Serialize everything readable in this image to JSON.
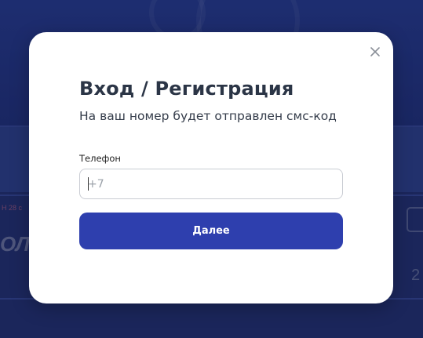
{
  "background": {
    "left_text": "ОЛЕ",
    "small_text": "Н 28 с",
    "right_number": "2"
  },
  "modal": {
    "title": "Вход / Регистрация",
    "subtitle": "На ваш номер будет отправлен смс-код",
    "phone_label": "Телефон",
    "phone_placeholder": "+7",
    "phone_value": "",
    "submit_label": "Далее",
    "close_icon": "close-icon"
  },
  "colors": {
    "accent": "#2e3fae",
    "title": "#2b3546",
    "backdrop": "#1b2a6b"
  }
}
